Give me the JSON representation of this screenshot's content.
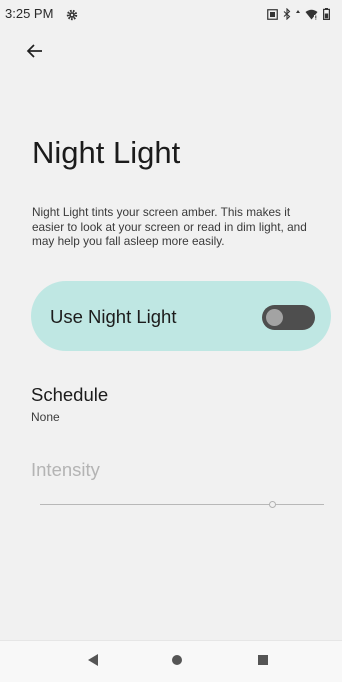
{
  "status_bar": {
    "time": "3:25 PM",
    "icons": [
      "settings-gear-icon",
      "screenshot-icon",
      "bluetooth-icon",
      "wifi-icon",
      "battery-icon"
    ]
  },
  "header": {
    "back_icon": "arrow-left-icon"
  },
  "page": {
    "title": "Night Light",
    "description": "Night Light tints your screen amber. This makes it easier to look at your screen or read in dim light, and may help you fall asleep more easily."
  },
  "night_light_toggle": {
    "label": "Use Night Light",
    "enabled": false,
    "card_color": "#bfe7e3"
  },
  "schedule": {
    "title": "Schedule",
    "value": "None"
  },
  "intensity": {
    "label": "Intensity",
    "value_fraction": 0.82,
    "disabled": true
  },
  "nav_bar": {
    "buttons": [
      "back-triangle-icon",
      "home-circle-icon",
      "recents-square-icon"
    ]
  }
}
